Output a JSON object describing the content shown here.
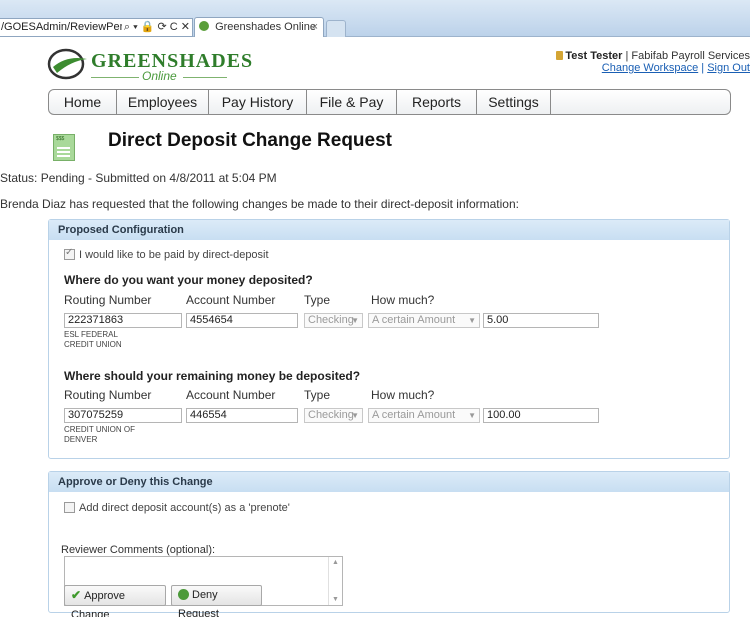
{
  "browser": {
    "address": "/GOESAdmin/ReviewPendi",
    "address_controls": "⌕ ▾ 🔒 ⟳ C ✕",
    "tab_title": "Greenshades Online",
    "tab_close": "×"
  },
  "logo": {
    "brand": "GREENSHADES",
    "sub": "Online"
  },
  "user": {
    "name": "Test Tester",
    "company": " | Fabifab Payroll Services",
    "change_workspace": "Change Workspace",
    "separator": " | ",
    "sign_out": "Sign Out"
  },
  "nav": {
    "items": [
      {
        "label": "Home"
      },
      {
        "label": "Employees"
      },
      {
        "label": "Pay History"
      },
      {
        "label": "File & Pay"
      },
      {
        "label": "Reports"
      },
      {
        "label": "Settings"
      }
    ]
  },
  "page": {
    "title": "Direct Deposit Change Request",
    "status": "Status: Pending - Submitted on 4/8/2011 at 5:04 PM",
    "intro": "Brenda Diaz has requested that the following changes be made to their direct-deposit information:"
  },
  "proposed": {
    "header": "Proposed Configuration",
    "paid_by_dd_label": "I would like to be paid by direct-deposit",
    "section1_title": "Where do you want your money deposited?",
    "section2_title": "Where should your remaining money be deposited?",
    "col_routing": "Routing Number",
    "col_account": "Account Number",
    "col_type": "Type",
    "col_howmuch": "How much?",
    "accounts": [
      {
        "routing": "222371863",
        "bank": "ESL FEDERAL CREDIT UNION",
        "account": "4554654",
        "type": "Checking",
        "amount_type": "A certain Amount",
        "amount": "5.00"
      },
      {
        "routing": "307075259",
        "bank": "CREDIT UNION OF DENVER",
        "account": "446554",
        "type": "Checking",
        "amount_type": "A certain Amount",
        "amount": "100.00"
      }
    ]
  },
  "approve": {
    "header": "Approve or Deny this Change",
    "prenote_label": "Add direct deposit account(s) as a 'prenote'",
    "comments_label": "Reviewer Comments (optional):",
    "approve_label": "Approve Change",
    "deny_label": "Deny Request"
  },
  "colors": {
    "brand_green": "#2f7d2b",
    "panel_header": "#c8def2",
    "link": "#1a5fb4"
  }
}
